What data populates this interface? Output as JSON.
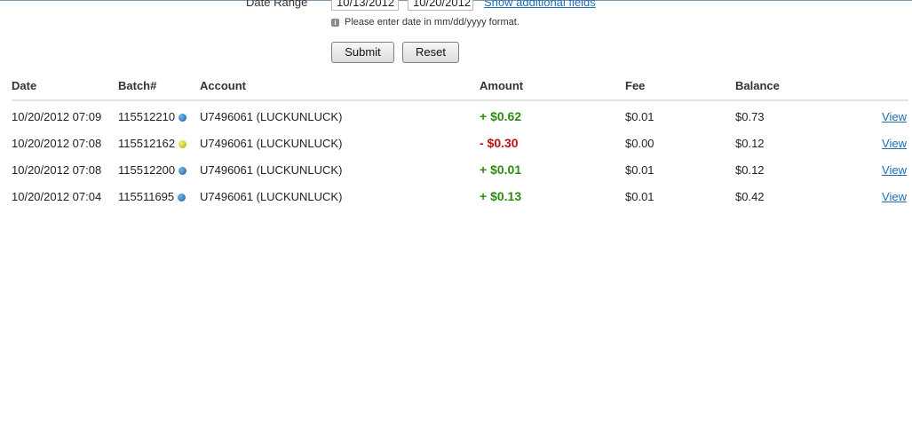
{
  "filter": {
    "date_range_label": "Date Range",
    "date_from": "10/13/2012",
    "date_to": "10/20/2012",
    "show_additional_link": "Show additional fields",
    "hint": "Please enter date in mm/dd/yyyy format.",
    "submit_label": "Submit",
    "reset_label": "Reset"
  },
  "table": {
    "headers": [
      "Date",
      "Batch#",
      "Account",
      "Amount",
      "Fee",
      "Balance"
    ],
    "rows": [
      {
        "date": "10/20/2012 07:09",
        "batch": "115512210",
        "status_color": "blue",
        "account": "U7496061 (LUCKUNLUCK)",
        "amount": "+ $0.62",
        "sign": "pos",
        "fee": "$0.01",
        "balance": "$0.73",
        "view": "View"
      },
      {
        "date": "10/20/2012 07:08",
        "batch": "115512162",
        "status_color": "yellow",
        "account": "U7496061 (LUCKUNLUCK)",
        "amount": "- $0.30",
        "sign": "neg",
        "fee": "$0.00",
        "balance": "$0.12",
        "view": "View"
      },
      {
        "date": "10/20/2012 07:08",
        "batch": "115512200",
        "status_color": "blue",
        "account": "U7496061 (LUCKUNLUCK)",
        "amount": "+ $0.01",
        "sign": "pos",
        "fee": "$0.01",
        "balance": "$0.12",
        "view": "View"
      },
      {
        "date": "10/20/2012 07:04",
        "batch": "115511695",
        "status_color": "blue",
        "account": "U7496061 (LUCKUNLUCK)",
        "amount": "+ $0.13",
        "sign": "pos",
        "fee": "$0.01",
        "balance": "$0.42",
        "view": "View"
      }
    ]
  },
  "colors": {
    "positive": "#2e8b12",
    "negative": "#c0110e",
    "link": "#1f6db4"
  }
}
